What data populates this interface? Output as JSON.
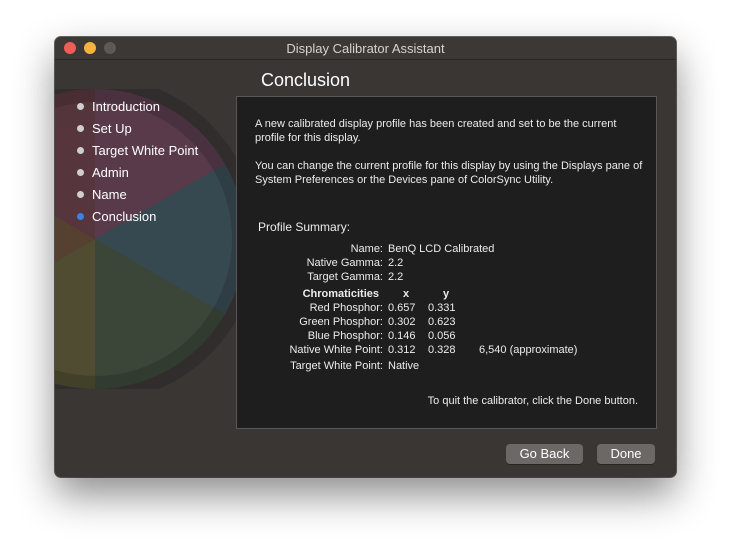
{
  "window": {
    "title": "Display Calibrator Assistant"
  },
  "heading": "Conclusion",
  "steps": [
    "Introduction",
    "Set Up",
    "Target White Point",
    "Admin",
    "Name",
    "Conclusion"
  ],
  "active_step": "Conclusion",
  "panel": {
    "paragraph1": "A new calibrated display profile has been created and set to be the current profile for this display.",
    "paragraph2": "You can change the current profile for this display by using the Displays pane of System Preferences or the Devices pane of ColorSync Utility.",
    "summary_title": "Profile Summary:",
    "name_label": "Name:",
    "name_value": "BenQ LCD Calibrated",
    "native_gamma_label": "Native Gamma:",
    "native_gamma_value": "2.2",
    "target_gamma_label": "Target Gamma:",
    "target_gamma_value": "2.2",
    "chromaticities_label": "Chromaticities",
    "x_header": "x",
    "y_header": "y",
    "red_label": "Red Phosphor:",
    "red_x": "0.657",
    "red_y": "0.331",
    "green_label": "Green Phosphor:",
    "green_x": "0.302",
    "green_y": "0.623",
    "blue_label": "Blue Phosphor:",
    "blue_x": "0.146",
    "blue_y": "0.056",
    "native_white_label": "Native White Point:",
    "native_white_x": "0.312",
    "native_white_y": "0.328",
    "native_white_temp": "6,540 (approximate)",
    "target_white_label": "Target White Point:",
    "target_white_value": "Native",
    "quit_text": "To quit the calibrator, click the Done button."
  },
  "buttons": {
    "back": "Go Back",
    "done": "Done"
  },
  "colors": {
    "accent": "#3b82e8",
    "close": "#ee5d56",
    "minimize": "#f4b33d"
  }
}
